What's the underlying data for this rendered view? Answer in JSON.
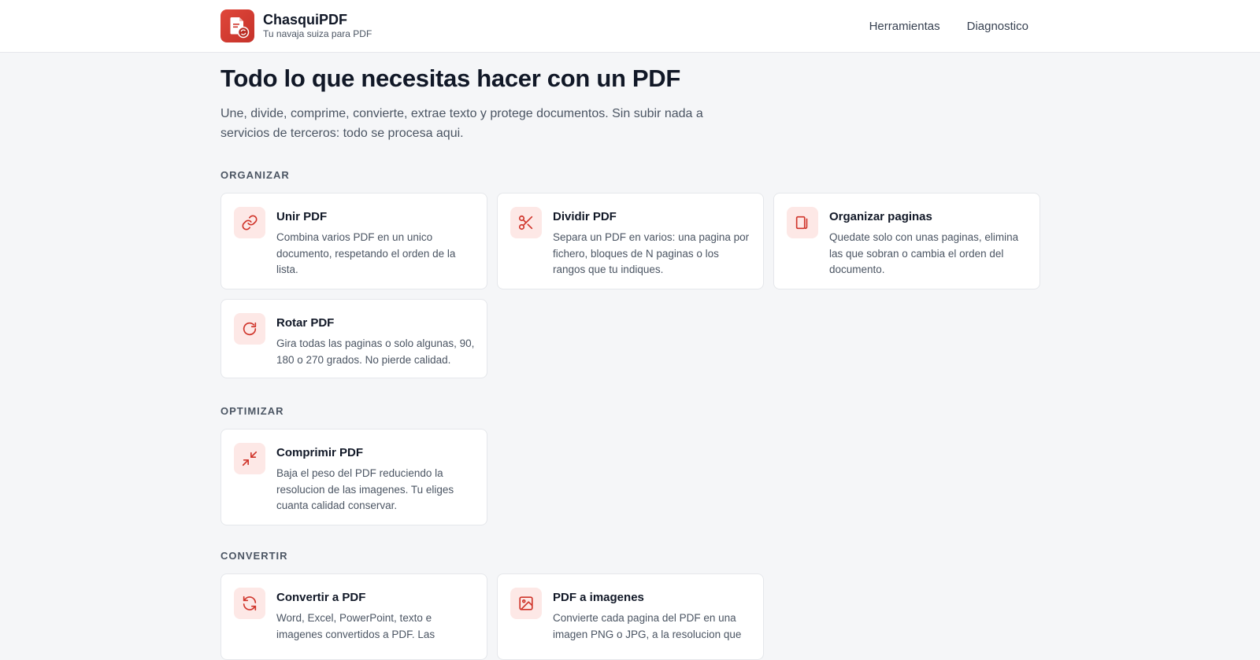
{
  "header": {
    "brand_name": "ChasquiPDF",
    "brand_tagline": "Tu navaja suiza para PDF",
    "nav": [
      {
        "label": "Herramientas"
      },
      {
        "label": "Diagnostico"
      }
    ]
  },
  "hero": {
    "title": "Todo lo que necesitas hacer con un PDF",
    "description": "Une, divide, comprime, convierte, extrae texto y protege documentos. Sin subir nada a servicios de terceros: todo se procesa aqui."
  },
  "sections": [
    {
      "label": "ORGANIZAR",
      "tools": [
        {
          "title": "Unir PDF",
          "description": "Combina varios PDF en un unico documento, respetando el orden de la lista.",
          "icon": "link-icon"
        },
        {
          "title": "Dividir PDF",
          "description": "Separa un PDF en varios: una pagina por fichero, bloques de N paginas o los rangos que tu indiques.",
          "icon": "scissors-icon"
        },
        {
          "title": "Organizar paginas",
          "description": "Quedate solo con unas paginas, elimina las que sobran o cambia el orden del documento.",
          "icon": "pages-icon"
        },
        {
          "title": "Rotar PDF",
          "description": "Gira todas las paginas o solo algunas, 90, 180 o 270 grados. No pierde calidad.",
          "icon": "rotate-icon"
        }
      ]
    },
    {
      "label": "OPTIMIZAR",
      "tools": [
        {
          "title": "Comprimir PDF",
          "description": "Baja el peso del PDF reduciendo la resolucion de las imagenes. Tu eliges cuanta calidad conservar.",
          "icon": "compress-icon"
        }
      ]
    },
    {
      "label": "CONVERTIR",
      "tools": [
        {
          "title": "Convertir a PDF",
          "description": "Word, Excel, PowerPoint, texto e imagenes convertidos a PDF. Las",
          "icon": "convert-icon"
        },
        {
          "title": "PDF a imagenes",
          "description": "Convierte cada pagina del PDF en una imagen PNG o JPG, a la resolucion que",
          "icon": "image-icon"
        }
      ]
    }
  ],
  "colors": {
    "accent": "#d0352b",
    "icon_bg": "#fde8e6",
    "background": "#f5f6f8"
  }
}
